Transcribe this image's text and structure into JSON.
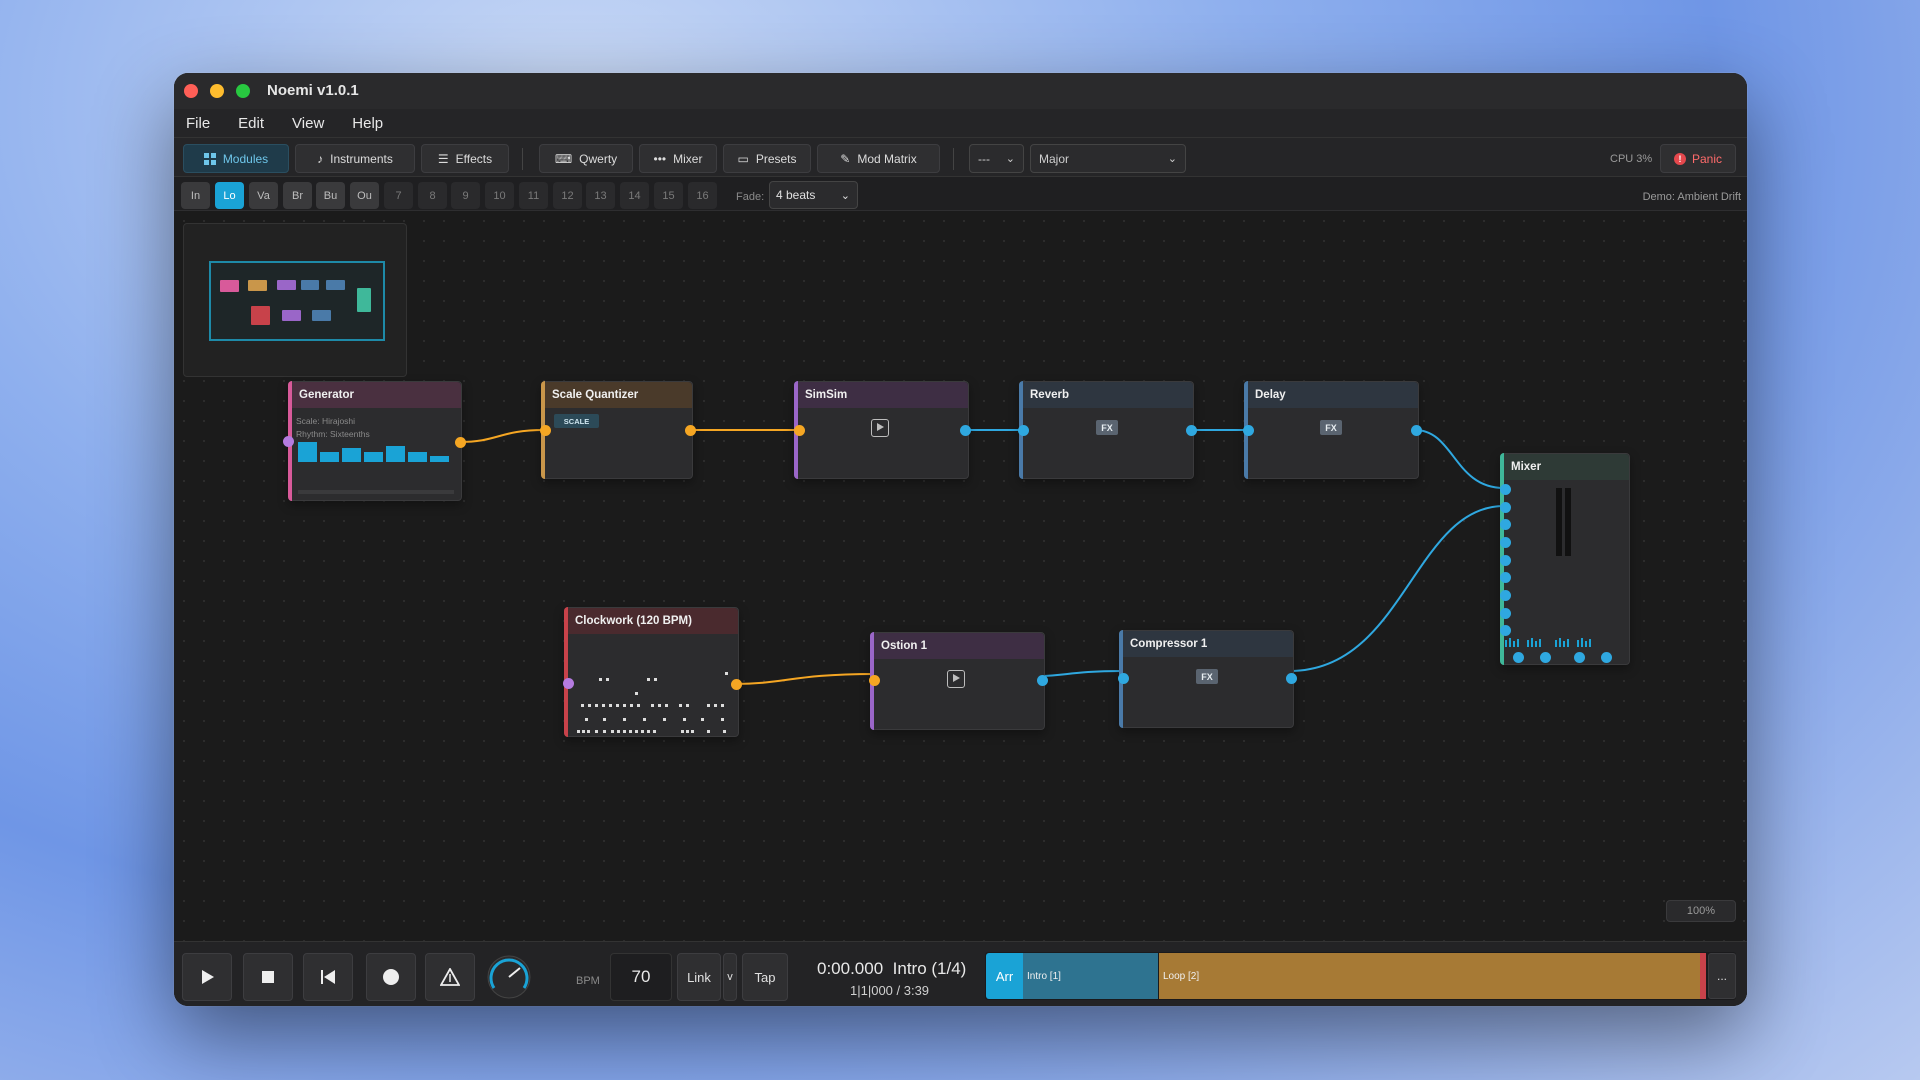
{
  "window": {
    "title": "Noemi v1.0.1"
  },
  "menu": [
    "File",
    "Edit",
    "View",
    "Help"
  ],
  "toolbar": {
    "modules": "Modules",
    "instruments": "Instruments",
    "effects": "Effects",
    "qwerty": "Qwerty",
    "mixer": "Mixer",
    "presets": "Presets",
    "mod_matrix": "Mod Matrix",
    "root_select": "---",
    "scale_select": "Major",
    "cpu": "CPU 3%",
    "panic": "Panic",
    "panic_icon": "!"
  },
  "lanes": [
    "In",
    "Lo",
    "Va",
    "Br",
    "Bu",
    "Ou",
    "7",
    "8",
    "9",
    "10",
    "11",
    "12",
    "13",
    "14",
    "15",
    "16"
  ],
  "fade": {
    "label": "Fade:",
    "value": "4 beats"
  },
  "demo": "Demo: Ambient Drift",
  "nodes": {
    "generator": {
      "title": "Generator",
      "scale": "Scale: Hirajoshi",
      "rhythm": "Rhythm: Sixteenths"
    },
    "scale_quantizer": {
      "title": "Scale Quantizer",
      "badge": "SCALE"
    },
    "simsim": {
      "title": "SimSim"
    },
    "reverb": {
      "title": "Reverb",
      "badge": "FX"
    },
    "delay": {
      "title": "Delay",
      "badge": "FX"
    },
    "mixer": {
      "title": "Mixer"
    },
    "clockwork": {
      "title": "Clockwork (120 BPM)"
    },
    "ostion": {
      "title": "Ostion 1"
    },
    "compressor": {
      "title": "Compressor 1",
      "badge": "FX"
    }
  },
  "zoom": "100%",
  "transport": {
    "bpm_label": "BPM",
    "bpm": "70",
    "link": "Link",
    "link_menu": "v",
    "tap": "Tap",
    "time": "0:00.000",
    "section": "Intro (1/4)",
    "position": "1|1|000 / 3:39",
    "arr": "Arr",
    "segments": [
      "Intro [1]",
      "Loop [2]"
    ],
    "more": "..."
  },
  "colors": {
    "accent_blue": "#1aa3d6",
    "cable_orange": "#f5a623",
    "cable_blue": "#2fa8e0",
    "panic_red": "#e5484d"
  }
}
